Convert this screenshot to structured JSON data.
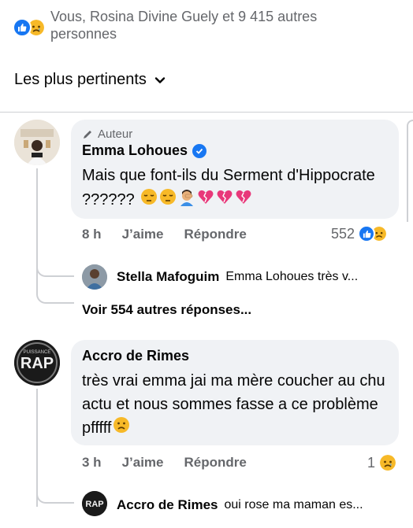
{
  "reactions": {
    "summary": "Vous, Rosina Divine Guely et 9 415 autres personnes",
    "icons": [
      "like-icon",
      "sad-icon"
    ]
  },
  "sort": {
    "label": "Les plus pertinents",
    "icon": "chevron-down-icon"
  },
  "comments": [
    {
      "badge": "Auteur",
      "author": "Emma Lohoues",
      "verified": true,
      "text": "Mais que font-ils du Serment d'Hippocrate ??????",
      "emojis": [
        "pensive",
        "pensive",
        "facepalm-man",
        "broken-heart",
        "broken-heart",
        "broken-heart"
      ],
      "time": "8 h",
      "like_label": "J’aime",
      "reply_label": "Répondre",
      "reaction_count": "552",
      "reply_preview": {
        "author": "Stella Mafoguim",
        "text": "Emma Lohoues  très v..."
      },
      "more_replies": "Voir 554 autres réponses..."
    },
    {
      "author": "Accro de Rimes",
      "text": "très vrai emma jai ma mère coucher au chu actu et nous sommes fasse a ce problème pfffff",
      "time": "3 h",
      "like_label": "J’aime",
      "reply_label": "Répondre",
      "reaction_count": "1",
      "reply_preview": {
        "author": "Accro de Rimes",
        "text": "oui rose ma maman es..."
      }
    }
  ],
  "colors": {
    "like_blue": "#1877f2",
    "bubble": "#f0f2f5",
    "muted": "#65676b",
    "heart": "#e8387a",
    "sad_yellow": "#f7b928"
  }
}
